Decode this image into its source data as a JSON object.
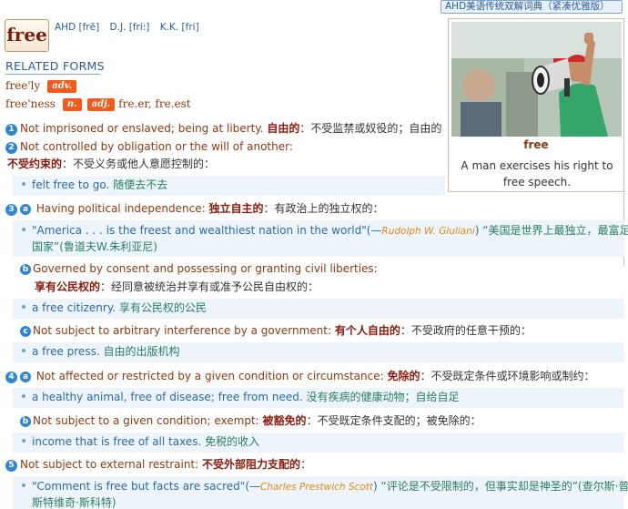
{
  "dict_badge": "AHD美语传统双解词典（紧凑优雅版）",
  "headword": "free",
  "pronunciations": [
    {
      "label": "AHD",
      "value": "[frē]"
    },
    {
      "label": "D.J.",
      "value": "[fri:]"
    },
    {
      "label": "K.K.",
      "value": "[fri]"
    }
  ],
  "related_forms_title": "RELATED FORMS",
  "related_forms": [
    {
      "word": "free'ly",
      "tags": [
        "adv."
      ],
      "extra": ""
    },
    {
      "word": "free'ness",
      "tags": [
        "n.",
        "adj."
      ],
      "extra": "fre.er, fre.est"
    }
  ],
  "image_card": {
    "title": "free",
    "caption": "A man exercises his right to free speech."
  },
  "senses": {
    "s1": {
      "num": "1",
      "en": "Not imprisoned or enslaved; being at liberty.",
      "zh_b": "自由的",
      "zh": "：不受监禁或奴役的；自由的"
    },
    "s2": {
      "num": "2",
      "en": "Not controlled by obligation or the will of another:",
      "zh_b": "不受约束的",
      "zh": "：不受义务或他人意愿控制的："
    },
    "ex2": {
      "en": "felt free to go.",
      "zh": "随便去不去"
    },
    "s3a": {
      "num": "3",
      "letter": "a",
      "en": "Having political independence:",
      "zh_b": "独立自主的",
      "zh": "：有政治上的独立权的："
    },
    "ex3a": {
      "en": "\"America . . . is the freest and wealthiest nation in the world\"",
      "src": "Rudolph W. Giuliani",
      "zh1": "“美国是世界上最独立，最富足的",
      "zh2": "国家”(鲁道夫W.朱利亚尼)"
    },
    "s3b": {
      "letter": "b",
      "en": "Governed by consent and possessing or granting civil liberties:",
      "zh_b": "享有公民权的",
      "zh": "：经同意被统治并享有或准予公民自由权的："
    },
    "ex3b": {
      "en": "a free citizenry.",
      "zh": "享有公民权的公民"
    },
    "s3c": {
      "letter": "c",
      "en": "Not subject to arbitrary interference by a government:",
      "zh_b": "有个人自由的",
      "zh": "：不受政府的任意干预的："
    },
    "ex3c": {
      "en": "a free press.",
      "zh": "自由的出版机构"
    },
    "s4a": {
      "num": "4",
      "letter": "a",
      "en": "Not affected or restricted by a given condition or circumstance:",
      "zh_b": "免除的",
      "zh": "：不受既定条件或环境影响或制约："
    },
    "ex4a": {
      "en": "a healthy animal, free of disease; free from need.",
      "zh": "没有疾病的健康动物；自给自足"
    },
    "s4b": {
      "letter": "b",
      "en": "Not subject to a given condition; exempt:",
      "zh_b": "被豁免的",
      "zh": "：不受既定条件支配的；被免除的："
    },
    "ex4b": {
      "en": "income that is free of all taxes.",
      "zh": "免税的收入"
    },
    "s5": {
      "num": "5",
      "en": "Not subject to external restraint:",
      "zh_b": "不受外部阻力支配的",
      "zh": "："
    },
    "ex5": {
      "en": "\"Comment is free but facts are sacred\"",
      "src": "Charles Prestwich Scott",
      "zh1": "“评论是不受限制的，但事实却是神圣的”(查尔斯·普雷",
      "zh2": "斯特维奇·斯科特)"
    }
  },
  "colors": {
    "accent_blue": "#2f86d3",
    "headword_red": "#8a1a0d",
    "pos_orange": "#f25a1e",
    "example_bg": "#edf4fb",
    "example_green": "#2a7f5f"
  },
  "icons": {
    "bullet": "dot",
    "number_badge": "circle"
  }
}
